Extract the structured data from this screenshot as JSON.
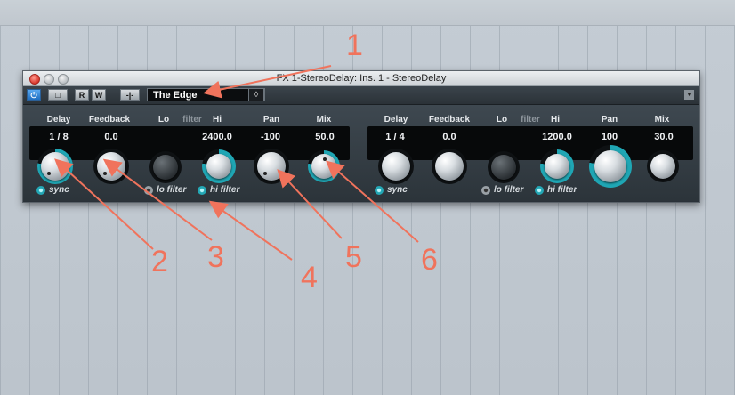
{
  "window": {
    "title": "FX 1-StereoDelay: Ins. 1 - StereoDelay"
  },
  "toolbar": {
    "power_label": "⏻",
    "bypass_label": "□",
    "read_label": "R",
    "write_label": "W",
    "sidechain_label": "-|-",
    "preset_name": "The Edge",
    "preset_menu_label": "◊",
    "collapse_label": "▼"
  },
  "delay1": {
    "labels": {
      "delay": "Delay",
      "feedback": "Feedback",
      "lo": "Lo",
      "filter": "filter",
      "hi": "Hi",
      "pan": "Pan",
      "mix": "Mix"
    },
    "values": {
      "delay": "1 / 8",
      "feedback": "0.0",
      "hi": "2400.0",
      "pan": "-100",
      "mix": "50.0"
    },
    "toggles": {
      "sync": "sync",
      "lo_filter": "lo filter",
      "hi_filter": "hi filter"
    }
  },
  "delay2": {
    "labels": {
      "delay": "Delay",
      "feedback": "Feedback",
      "lo": "Lo",
      "filter": "filter",
      "hi": "Hi",
      "pan": "Pan",
      "mix": "Mix"
    },
    "values": {
      "delay": "1 / 4",
      "feedback": "0.0",
      "hi": "1200.0",
      "pan": "100",
      "mix": "30.0"
    },
    "toggles": {
      "sync": "sync",
      "lo_filter": "lo filter",
      "hi_filter": "hi filter"
    }
  },
  "annotations": [
    "1",
    "2",
    "3",
    "4",
    "5",
    "6"
  ],
  "colors": {
    "accent": "#1fa6b4",
    "annotation": "#f0735c"
  }
}
